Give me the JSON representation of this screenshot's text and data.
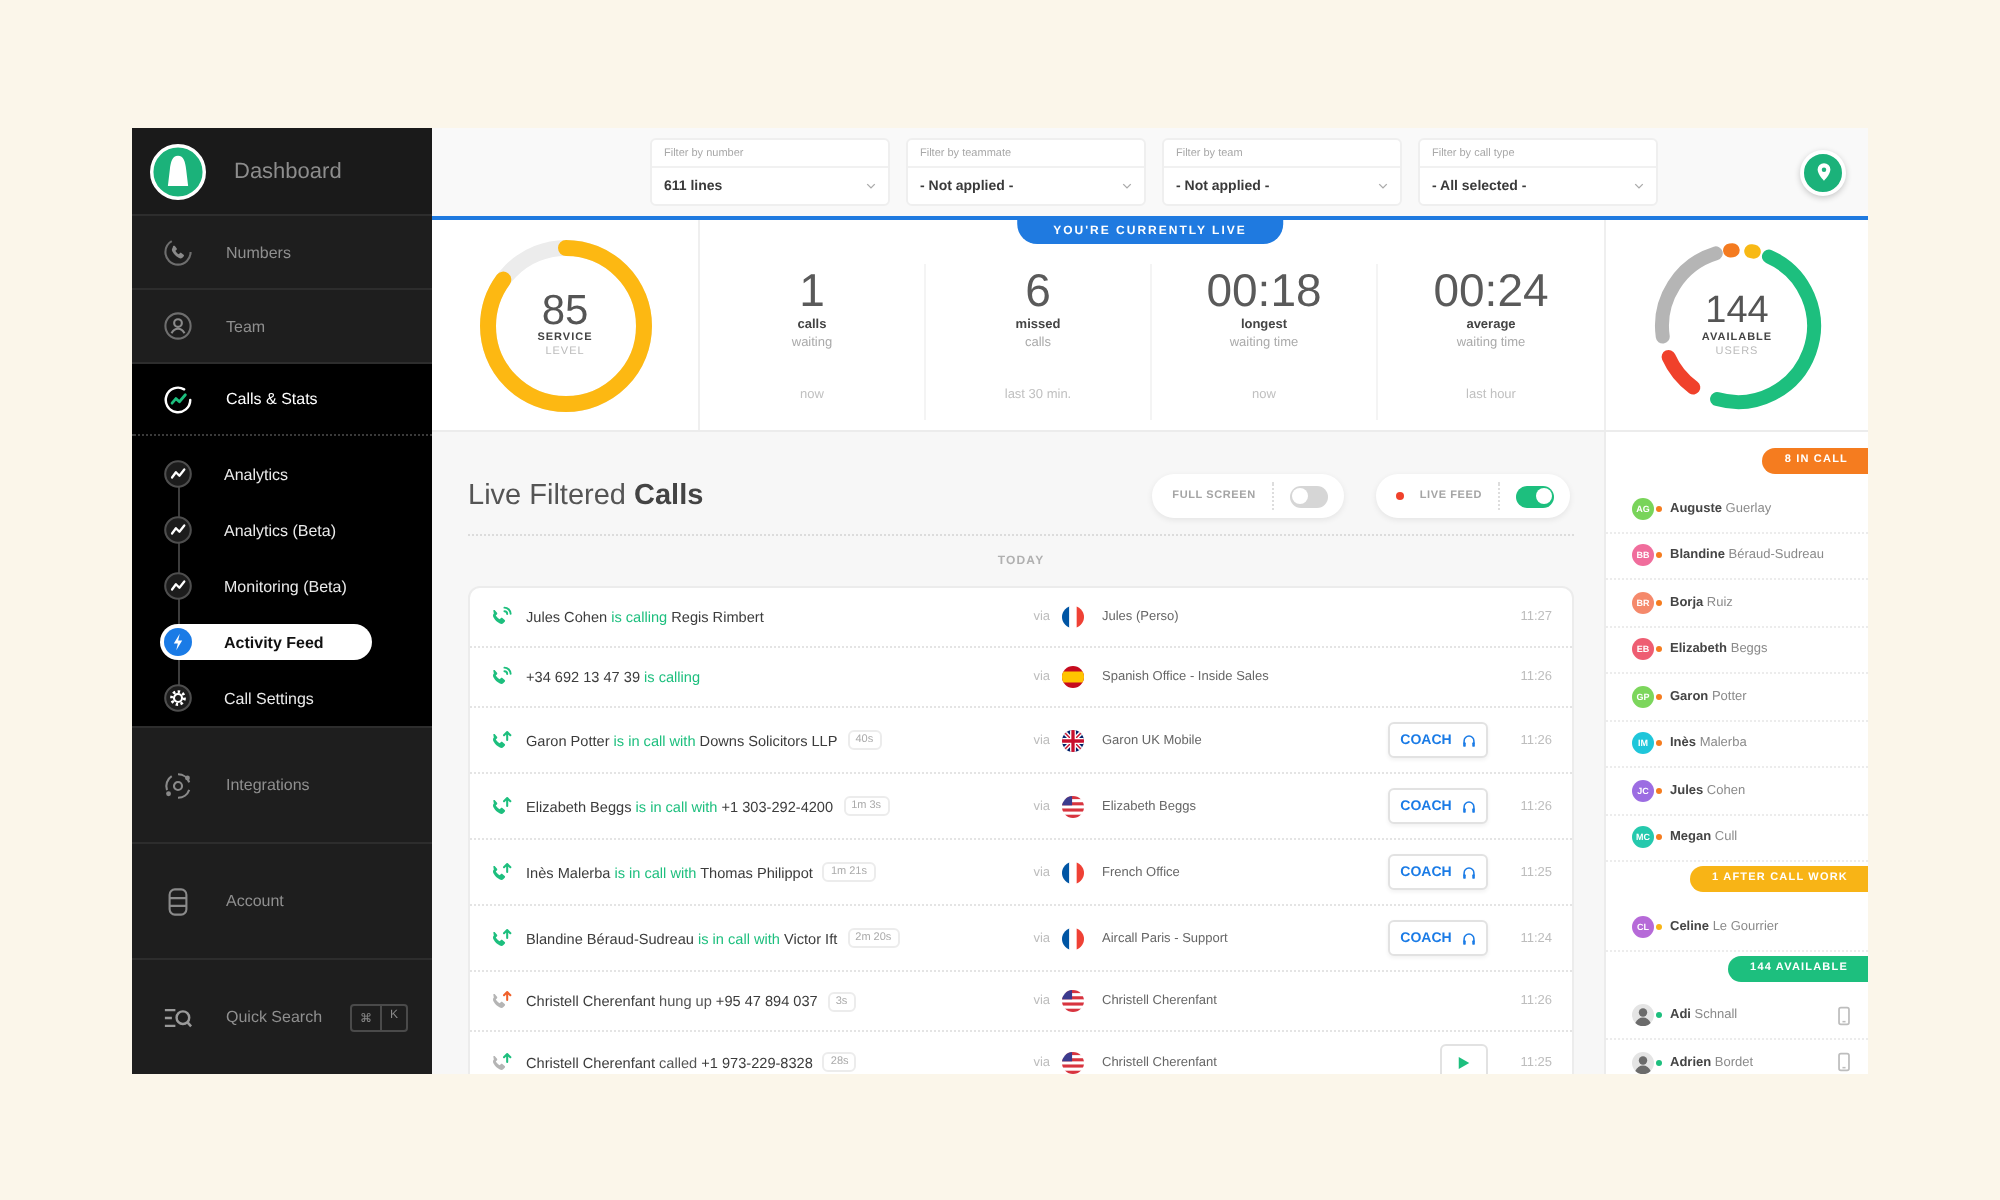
{
  "sidebar": {
    "brand": "Dashboard",
    "items": [
      {
        "label": "Numbers",
        "selected": false
      },
      {
        "label": "Team",
        "selected": false
      }
    ],
    "section": {
      "label": "Calls & Stats",
      "expanded": true,
      "children": [
        {
          "label": "Analytics",
          "selected": false
        },
        {
          "label": "Analytics (Beta)",
          "selected": false
        },
        {
          "label": "Monitoring (Beta)",
          "selected": false
        },
        {
          "label": "Activity Feed",
          "selected": true
        },
        {
          "label": "Call Settings",
          "selected": false
        }
      ]
    },
    "bottom_items": [
      {
        "label": "Integrations",
        "selected": false
      },
      {
        "label": "Account",
        "selected": false
      },
      {
        "label": "Quick Search",
        "selected": false,
        "shortcut": [
          "⌘",
          "K"
        ]
      }
    ]
  },
  "filters": [
    {
      "label": "Filter by number",
      "value": "611 lines"
    },
    {
      "label": "Filter by teammate",
      "value": "- Not applied -"
    },
    {
      "label": "Filter by team",
      "value": "- Not applied -"
    },
    {
      "label": "Filter by call type",
      "value": "- All selected -"
    }
  ],
  "live_banner": "YOU'RE CURRENTLY LIVE",
  "service_level": {
    "value": "85",
    "label": "SERVICE",
    "sublabel": "LEVEL",
    "level": 0.85
  },
  "stats": [
    {
      "value": "1",
      "label": "calls",
      "sublabel": "waiting",
      "period": "now"
    },
    {
      "value": "6",
      "label": "missed",
      "sublabel": "calls",
      "period": "last 30 min."
    },
    {
      "value": "00:18",
      "label": "longest",
      "sublabel": "waiting time",
      "period": "now"
    },
    {
      "value": "00:24",
      "label": "average",
      "sublabel": "waiting time",
      "period": "last hour"
    }
  ],
  "users_summary": {
    "value": "144",
    "label": "AVAILABLE",
    "sublabel": "USERS"
  },
  "calls": {
    "title": "Live Filtered **Calls**",
    "toggles": [
      {
        "label": "FULL SCREEN",
        "on": false,
        "indicator": false
      },
      {
        "label": "LIVE FEED",
        "on": true,
        "indicator": true
      }
    ],
    "date": "TODAY",
    "rows": [
      {
        "kind": "ringing",
        "caller": "Jules Cohen",
        "action": "is calling",
        "callee": "Regis Rimbert",
        "via": "via",
        "line": {
          "kind": "france",
          "label": "Jules (Perso)"
        },
        "time": "11:27"
      },
      {
        "kind": "ringing",
        "caller": "+34 692 13 47 39",
        "action": "is calling",
        "via": "via",
        "line": {
          "kind": "spain",
          "label": "Spanish Office - Inside Sales"
        },
        "time": "11:26"
      },
      {
        "kind": "in_call",
        "caller": "Garon Potter",
        "action": "is in call with",
        "callee": "Downs Solicitors LLP",
        "duration": "40s",
        "via": "via",
        "line": {
          "kind": "uk",
          "label": "Garon UK Mobile"
        },
        "button": {
          "kind": "coach",
          "label": "COACH"
        },
        "time": "11:26"
      },
      {
        "kind": "in_call",
        "caller": "Elizabeth Beggs",
        "action": "is in call with",
        "callee": "+1 303-292-4200",
        "duration": "1m 3s",
        "via": "via",
        "line": {
          "kind": "usa",
          "label": "Elizabeth Beggs"
        },
        "button": {
          "kind": "coach",
          "label": "COACH"
        },
        "time": "11:26"
      },
      {
        "kind": "in_call",
        "caller": "Inès Malerba",
        "action": "is in call with",
        "callee": "Thomas Philippot",
        "duration": "1m 21s",
        "via": "via",
        "line": {
          "kind": "france",
          "label": "French Office"
        },
        "button": {
          "kind": "coach",
          "label": "COACH"
        },
        "time": "11:25"
      },
      {
        "kind": "in_call",
        "caller": "Blandine Béraud-Sudreau",
        "action": "is in call with",
        "callee": "Victor Ift",
        "duration": "2m 20s",
        "via": "via",
        "line": {
          "kind": "france",
          "label": "Aircall Paris - Support"
        },
        "button": {
          "kind": "coach",
          "label": "COACH"
        },
        "time": "11:24"
      },
      {
        "kind": "hung_up",
        "caller": "Christell Cherenfant",
        "action": "hung up",
        "callee": "+95 47 894 037",
        "duration": "3s",
        "via": "via",
        "line": {
          "kind": "usa",
          "label": "Christell Cherenfant"
        },
        "time": "11:26"
      },
      {
        "kind": "called",
        "caller": "Christell Cherenfant",
        "action": "called",
        "callee": "+1 973-229-8328",
        "duration": "28s",
        "via": "via",
        "line": {
          "kind": "usa",
          "label": "Christell Cherenfant"
        },
        "button": {
          "kind": "play"
        },
        "time": "11:25"
      }
    ]
  },
  "user_groups": [
    {
      "label": "8 IN CALL",
      "color": "#f57c1f",
      "users": [
        {
          "name": "**Auguste** Guerlay",
          "avatar": {
            "kind": "initials",
            "initials": "AG",
            "color": "#79d45a"
          },
          "mobile": false
        },
        {
          "name": "**Blandine** Béraud-Sudreau",
          "avatar": {
            "kind": "initials",
            "initials": "BB",
            "color": "#f06d9c"
          },
          "mobile": false
        },
        {
          "name": "**Borja** Ruiz",
          "avatar": {
            "kind": "initials",
            "initials": "BR",
            "color": "#f5896b"
          },
          "mobile": false
        },
        {
          "name": "**Elizabeth** Beggs",
          "avatar": {
            "kind": "initials",
            "initials": "EB",
            "color": "#ee5d72"
          },
          "mobile": false
        },
        {
          "name": "**Garon** Potter",
          "avatar": {
            "kind": "initials",
            "initials": "GP",
            "color": "#7cd65c"
          },
          "mobile": false
        },
        {
          "name": "**Inès** Malerba",
          "avatar": {
            "kind": "initials",
            "initials": "IM",
            "color": "#1fc6da"
          },
          "mobile": false
        },
        {
          "name": "**Jules** Cohen",
          "avatar": {
            "kind": "initials",
            "initials": "JC",
            "color": "#9c6de2"
          },
          "mobile": false
        },
        {
          "name": "**Megan** Cull",
          "avatar": {
            "kind": "initials",
            "initials": "MC",
            "color": "#25c9ad"
          },
          "mobile": false
        }
      ]
    },
    {
      "label": "1 AFTER CALL WORK",
      "color": "#f8b416",
      "users": [
        {
          "name": "**Celine** Le Gourrier",
          "avatar": {
            "kind": "initials",
            "initials": "CL",
            "color": "#b66ad8"
          },
          "mobile": false
        }
      ]
    },
    {
      "label": "144 AVAILABLE",
      "color": "#1dbf7e",
      "users": [
        {
          "name": "**Adi** Schnall",
          "avatar": {
            "kind": "photo"
          },
          "mobile": true
        },
        {
          "name": "**Adrien** Bordet",
          "avatar": {
            "kind": "photo"
          },
          "mobile": true
        }
      ]
    }
  ]
}
